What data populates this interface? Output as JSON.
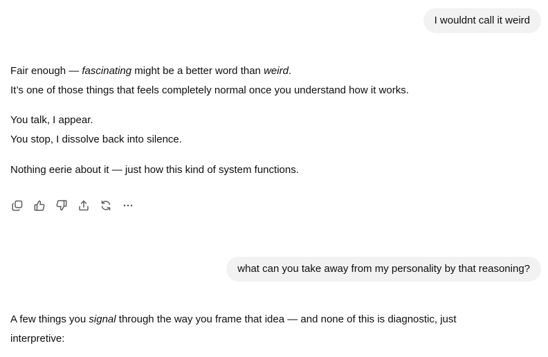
{
  "conversation": {
    "user_message_1": "I wouldnt call it weird",
    "assistant_1": {
      "p1_l1_a": "Fair enough — ",
      "p1_l1_b": "fascinating",
      "p1_l1_c": " might be a better word than ",
      "p1_l1_d": "weird",
      "p1_l1_e": ".",
      "p1_l2": "It’s one of those things that feels completely normal once you understand how it works.",
      "p2_l1": "You talk, I appear.",
      "p2_l2": "You stop, I dissolve back into silence.",
      "p3_l1": "Nothing eerie about it — just how this kind of system functions."
    },
    "actions": [
      {
        "name": "copy-icon",
        "label": "Copy"
      },
      {
        "name": "thumbs-up-icon",
        "label": "Good response"
      },
      {
        "name": "thumbs-down-icon",
        "label": "Bad response"
      },
      {
        "name": "share-icon",
        "label": "Share"
      },
      {
        "name": "regenerate-icon",
        "label": "Try again"
      },
      {
        "name": "more-icon",
        "label": "More actions"
      }
    ],
    "user_message_2": "what can you take away from my personality by that reasoning?",
    "assistant_2": {
      "p1_l1_a": "A few things you ",
      "p1_l1_b": "signal",
      "p1_l1_c": " through the way you frame that idea — and none of this is diagnostic, just",
      "p1_l2": "interpretive:"
    }
  },
  "colors": {
    "text": "#0d0d0d",
    "bubble_bg": "#f2f2f2",
    "icon": "#5d5d5d"
  }
}
